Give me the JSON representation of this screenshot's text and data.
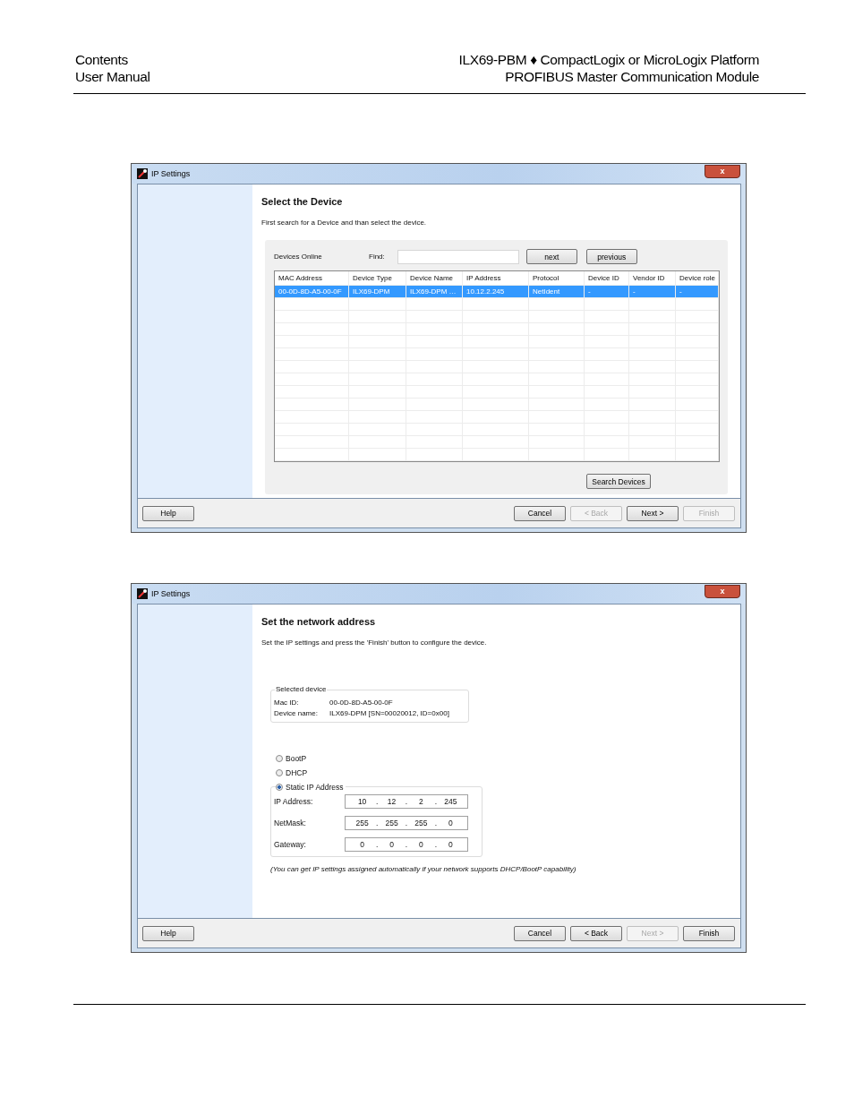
{
  "header": {
    "left": [
      "Contents",
      "User Manual"
    ],
    "right": [
      "ILX69-PBM ♦ CompactLogix or MicroLogix Platform",
      "PROFIBUS Master Communication Module"
    ]
  },
  "dialogs": [
    {
      "kind": "select",
      "title": "IP Settings",
      "close": "x",
      "heading": "Select the Device",
      "description": "First search for a Device and than select the device.",
      "devices_label": "Devices Online",
      "find_label": "Find:",
      "find_buttons": [
        "next",
        "previous"
      ],
      "table": {
        "columns": [
          "MAC Address",
          "Device Type",
          "Device Name",
          "IP Address",
          "Protocol",
          "Device ID",
          "Vendor ID",
          "Device role"
        ],
        "rows": [
          {
            "selected": true,
            "cells": [
              "00-0D-8D-A5-00-0F",
              "ILX69-DPM",
              "ILX69-DPM …",
              "10.12.2.245",
              "NetIdent",
              "-",
              "-",
              "-"
            ]
          }
        ]
      },
      "search_button": "Search Devices",
      "help": "Help",
      "buttons": [
        {
          "label": "Cancel",
          "disabled": false
        },
        {
          "label": "< Back",
          "disabled": true
        },
        {
          "label": "Next >",
          "disabled": false
        },
        {
          "label": "Finish",
          "disabled": true
        }
      ]
    },
    {
      "kind": "network",
      "title": "IP Settings",
      "close": "x",
      "heading": "Set the network address",
      "description": "Set the IP settings and press the 'Finish' button to configure the device.",
      "selected_device": {
        "legend": "Selected device",
        "rows": [
          {
            "label": "Mac ID:",
            "value": "00-0D-8D-A5-00-0F"
          },
          {
            "label": "Device name:",
            "value": "ILX69-DPM [SN=00020012, ID=0x00]"
          }
        ]
      },
      "modes": [
        {
          "label": "BootP",
          "selected": false
        },
        {
          "label": "DHCP",
          "selected": false
        },
        {
          "label": "Static IP Address",
          "selected": true
        }
      ],
      "ip_fields": [
        {
          "label": "IP Address:",
          "octets": [
            "10",
            "12",
            "2",
            "245"
          ]
        },
        {
          "label": "NetMask:",
          "octets": [
            "255",
            "255",
            "255",
            "0"
          ]
        },
        {
          "label": "Gateway:",
          "octets": [
            "0",
            "0",
            "0",
            "0"
          ]
        }
      ],
      "separator": ".",
      "note": "(You can get IP settings assigned automatically if your network supports DHCP/BootP capability)",
      "help": "Help",
      "buttons": [
        {
          "label": "Cancel",
          "disabled": false
        },
        {
          "label": "< Back",
          "disabled": false
        },
        {
          "label": "Next >",
          "disabled": true
        },
        {
          "label": "Finish",
          "disabled": false
        }
      ]
    }
  ]
}
